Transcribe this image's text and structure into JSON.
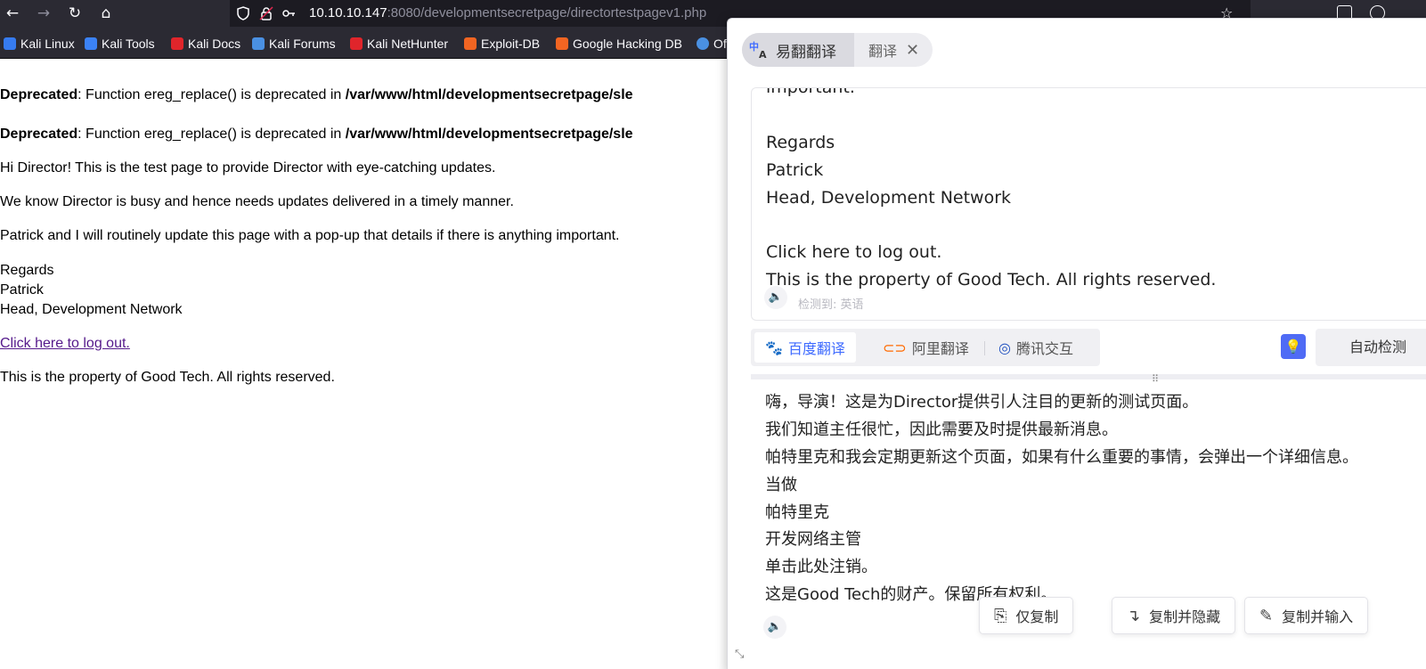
{
  "browser": {
    "url_host": "10.10.10.147",
    "url_path": ":8080/developmentsecretpage/directortestpagev1.php",
    "bookmarks": [
      {
        "label": "Kali Linux",
        "color": "#367bf0"
      },
      {
        "label": "Kali Tools",
        "color": "#3b82f6"
      },
      {
        "label": "Kali Docs",
        "color": "#e0252b"
      },
      {
        "label": "Kali Forums",
        "color": "#4a90e2"
      },
      {
        "label": "Kali NetHunter",
        "color": "#e0252b"
      },
      {
        "label": "Exploit-DB",
        "color": "#f26522"
      },
      {
        "label": "Google Hacking DB",
        "color": "#f26522"
      },
      {
        "label": "Of",
        "color": "#4a90e2"
      }
    ]
  },
  "page": {
    "deprecated_label": "Deprecated",
    "deprecated_msg": ": Function ereg_replace() is deprecated in ",
    "deprecated_path": "/var/www/html/developmentsecretpage/sle",
    "p1": "Hi Director! This is the test page to provide Director with eye-catching updates.",
    "p2": "We know Director is busy and hence needs updates delivered in a timely manner.",
    "p3": "Patrick and I will routinely update this page with a pop-up that details if there is anything important.",
    "regards": "Regards",
    "name": "Patrick",
    "role": "Head, Development Network",
    "logout_link": "Click here to log out.",
    "footer": "This is the property of Good Tech. All rights reserved."
  },
  "translator": {
    "tab_main": "易翻翻译",
    "tab_sub": "翻译",
    "source_lines": [
      "important.",
      "Regards",
      "Patrick",
      "Head, Development Network",
      "Click here to log out.",
      "This is the property of Good Tech. All rights reserved."
    ],
    "detected": "检测到: 英语",
    "engines": [
      "百度翻译",
      "阿里翻译",
      "腾讯交互"
    ],
    "auto_detect": "自动检测",
    "result_lines": [
      "嗨，导演！这是为Director提供引人注目的更新的测试页面。",
      "我们知道主任很忙，因此需要及时提供最新消息。",
      "帕特里克和我会定期更新这个页面，如果有什么重要的事情，会弹出一个详细信息。",
      "当做",
      "帕特里克",
      "开发网络主管",
      "单击此处注销。",
      "这是Good Tech的财产。保留所有权利。"
    ],
    "actions": {
      "copy_only": "仅复制",
      "copy_hide": "复制并隐藏",
      "copy_input": "复制并输入"
    },
    "accent": "#3f6bff"
  }
}
